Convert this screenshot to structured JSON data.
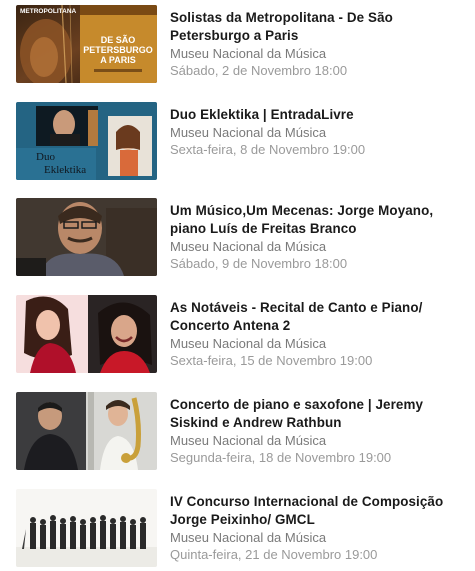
{
  "events": [
    {
      "title_line1": "Solistas da Metropolitana - De São",
      "title_line2": "Petersburgo a Paris",
      "venue": "Museu Nacional da Música",
      "date": "Sábado, 2 de Novembro 18:00",
      "image_text": {
        "brand": "METROPOLITANA",
        "line1": "DE SÃO",
        "line2": "PETERSBURGO",
        "line3": "A PARIS"
      }
    },
    {
      "title_line1": "Duo Eklektika | EntradaLivre",
      "title_line2": "",
      "venue": "Museu Nacional da Música",
      "date": "Sexta-feira, 8 de Novembro 19:00",
      "image_text": {
        "line1": "Duo",
        "line2": "Eklektika"
      }
    },
    {
      "title_line1": "Um Músico,Um Mecenas: Jorge Moyano,",
      "title_line2": "piano Luís de Freitas Branco",
      "venue": "Museu Nacional da Música",
      "date": "Sábado, 9 de Novembro 18:00"
    },
    {
      "title_line1": "As Notáveis - Recital de Canto e Piano/",
      "title_line2": "Concerto Antena 2",
      "venue": "Museu Nacional da Música",
      "date": "Sexta-feira, 15 de Novembro 19:00"
    },
    {
      "title_line1": "Concerto de piano e saxofone | Jeremy",
      "title_line2": "Siskind e Andrew Rathbun",
      "venue": "Museu Nacional da Música",
      "date": "Segunda-feira, 18 de Novembro 19:00"
    },
    {
      "title_line1": "IV Concurso Internacional de Composição",
      "title_line2": "Jorge Peixinho/ GMCL",
      "venue": "Museu Nacional da Música",
      "date": "Quinta-feira, 21 de Novembro 19:00"
    }
  ]
}
